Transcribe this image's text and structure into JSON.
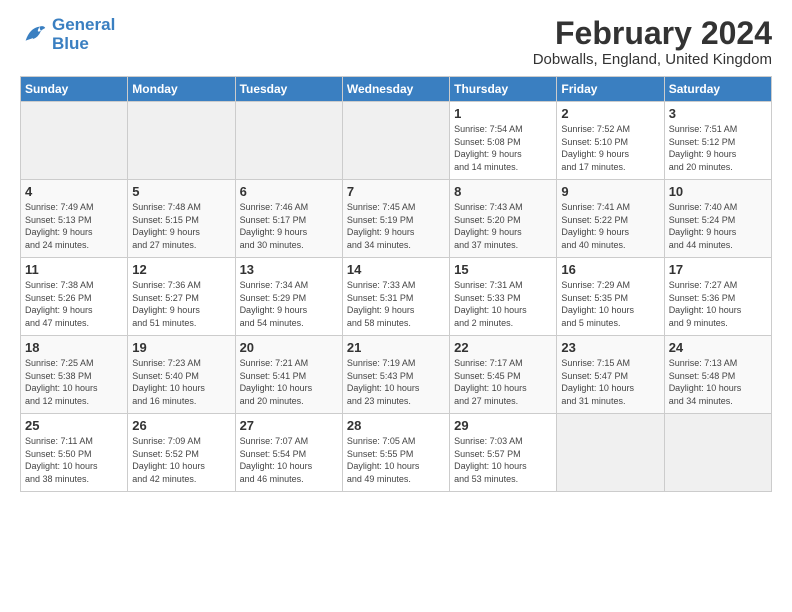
{
  "logo": {
    "line1": "General",
    "line2": "Blue"
  },
  "title": "February 2024",
  "subtitle": "Dobwalls, England, United Kingdom",
  "headers": [
    "Sunday",
    "Monday",
    "Tuesday",
    "Wednesday",
    "Thursday",
    "Friday",
    "Saturday"
  ],
  "weeks": [
    [
      {
        "day": "",
        "info": ""
      },
      {
        "day": "",
        "info": ""
      },
      {
        "day": "",
        "info": ""
      },
      {
        "day": "",
        "info": ""
      },
      {
        "day": "1",
        "info": "Sunrise: 7:54 AM\nSunset: 5:08 PM\nDaylight: 9 hours\nand 14 minutes."
      },
      {
        "day": "2",
        "info": "Sunrise: 7:52 AM\nSunset: 5:10 PM\nDaylight: 9 hours\nand 17 minutes."
      },
      {
        "day": "3",
        "info": "Sunrise: 7:51 AM\nSunset: 5:12 PM\nDaylight: 9 hours\nand 20 minutes."
      }
    ],
    [
      {
        "day": "4",
        "info": "Sunrise: 7:49 AM\nSunset: 5:13 PM\nDaylight: 9 hours\nand 24 minutes."
      },
      {
        "day": "5",
        "info": "Sunrise: 7:48 AM\nSunset: 5:15 PM\nDaylight: 9 hours\nand 27 minutes."
      },
      {
        "day": "6",
        "info": "Sunrise: 7:46 AM\nSunset: 5:17 PM\nDaylight: 9 hours\nand 30 minutes."
      },
      {
        "day": "7",
        "info": "Sunrise: 7:45 AM\nSunset: 5:19 PM\nDaylight: 9 hours\nand 34 minutes."
      },
      {
        "day": "8",
        "info": "Sunrise: 7:43 AM\nSunset: 5:20 PM\nDaylight: 9 hours\nand 37 minutes."
      },
      {
        "day": "9",
        "info": "Sunrise: 7:41 AM\nSunset: 5:22 PM\nDaylight: 9 hours\nand 40 minutes."
      },
      {
        "day": "10",
        "info": "Sunrise: 7:40 AM\nSunset: 5:24 PM\nDaylight: 9 hours\nand 44 minutes."
      }
    ],
    [
      {
        "day": "11",
        "info": "Sunrise: 7:38 AM\nSunset: 5:26 PM\nDaylight: 9 hours\nand 47 minutes."
      },
      {
        "day": "12",
        "info": "Sunrise: 7:36 AM\nSunset: 5:27 PM\nDaylight: 9 hours\nand 51 minutes."
      },
      {
        "day": "13",
        "info": "Sunrise: 7:34 AM\nSunset: 5:29 PM\nDaylight: 9 hours\nand 54 minutes."
      },
      {
        "day": "14",
        "info": "Sunrise: 7:33 AM\nSunset: 5:31 PM\nDaylight: 9 hours\nand 58 minutes."
      },
      {
        "day": "15",
        "info": "Sunrise: 7:31 AM\nSunset: 5:33 PM\nDaylight: 10 hours\nand 2 minutes."
      },
      {
        "day": "16",
        "info": "Sunrise: 7:29 AM\nSunset: 5:35 PM\nDaylight: 10 hours\nand 5 minutes."
      },
      {
        "day": "17",
        "info": "Sunrise: 7:27 AM\nSunset: 5:36 PM\nDaylight: 10 hours\nand 9 minutes."
      }
    ],
    [
      {
        "day": "18",
        "info": "Sunrise: 7:25 AM\nSunset: 5:38 PM\nDaylight: 10 hours\nand 12 minutes."
      },
      {
        "day": "19",
        "info": "Sunrise: 7:23 AM\nSunset: 5:40 PM\nDaylight: 10 hours\nand 16 minutes."
      },
      {
        "day": "20",
        "info": "Sunrise: 7:21 AM\nSunset: 5:41 PM\nDaylight: 10 hours\nand 20 minutes."
      },
      {
        "day": "21",
        "info": "Sunrise: 7:19 AM\nSunset: 5:43 PM\nDaylight: 10 hours\nand 23 minutes."
      },
      {
        "day": "22",
        "info": "Sunrise: 7:17 AM\nSunset: 5:45 PM\nDaylight: 10 hours\nand 27 minutes."
      },
      {
        "day": "23",
        "info": "Sunrise: 7:15 AM\nSunset: 5:47 PM\nDaylight: 10 hours\nand 31 minutes."
      },
      {
        "day": "24",
        "info": "Sunrise: 7:13 AM\nSunset: 5:48 PM\nDaylight: 10 hours\nand 34 minutes."
      }
    ],
    [
      {
        "day": "25",
        "info": "Sunrise: 7:11 AM\nSunset: 5:50 PM\nDaylight: 10 hours\nand 38 minutes."
      },
      {
        "day": "26",
        "info": "Sunrise: 7:09 AM\nSunset: 5:52 PM\nDaylight: 10 hours\nand 42 minutes."
      },
      {
        "day": "27",
        "info": "Sunrise: 7:07 AM\nSunset: 5:54 PM\nDaylight: 10 hours\nand 46 minutes."
      },
      {
        "day": "28",
        "info": "Sunrise: 7:05 AM\nSunset: 5:55 PM\nDaylight: 10 hours\nand 49 minutes."
      },
      {
        "day": "29",
        "info": "Sunrise: 7:03 AM\nSunset: 5:57 PM\nDaylight: 10 hours\nand 53 minutes."
      },
      {
        "day": "",
        "info": ""
      },
      {
        "day": "",
        "info": ""
      }
    ]
  ]
}
